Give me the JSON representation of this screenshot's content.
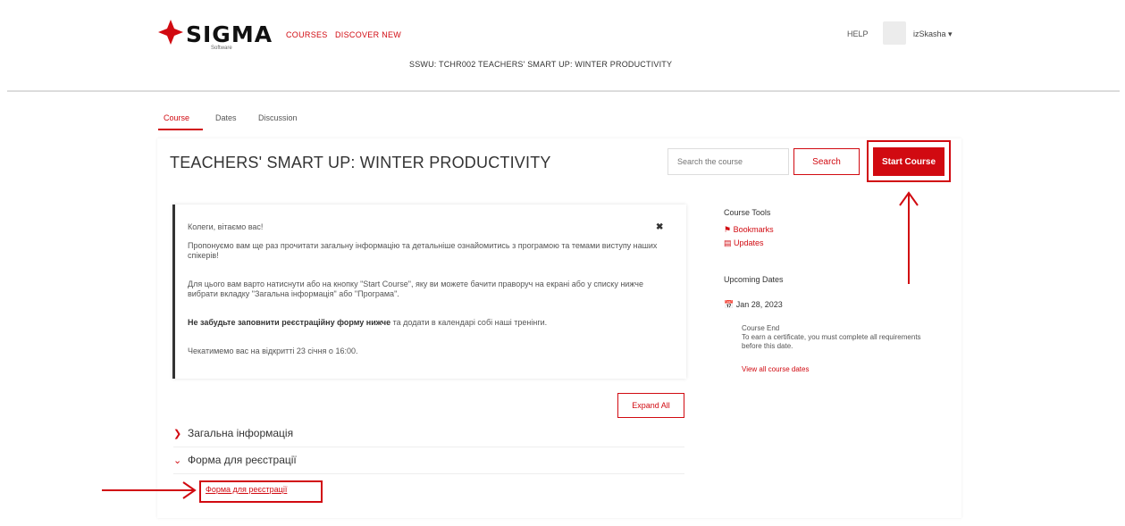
{
  "header": {
    "logo_text": "SIGMA",
    "logo_sub": "Software",
    "nav": [
      "COURSES",
      "DISCOVER NEW"
    ],
    "course_crumb": "SSWU: TCHR002 TEACHERS' SMART UP: WINTER PRODUCTIVITY",
    "help": "HELP",
    "username": "izSkasha ▾"
  },
  "tabs": [
    "Course",
    "Dates",
    "Discussion"
  ],
  "course": {
    "title": "TEACHERS' SMART UP: WINTER PRODUCTIVITY",
    "search_placeholder": "Search the course",
    "search_label": "Search",
    "start_label": "Start Course"
  },
  "welcome": {
    "greeting": "Колеги, вітаємо вас!",
    "p1": "Пропонуємо вам ще раз прочитати загальну інформацію та детальніше ознайомитись з програмою та темами виступу наших спікерів!",
    "p2": "Для цього вам варто натиснути або на кнопку \"Start Course\", яку ви можете бачити праворуч на екрані або у списку нижче вибрати вкладку \"Загальна інформація\" або \"Програма\".",
    "p3_bold": "Не забудьте заповнити реєстраційну форму нижче",
    "p3_rest": " та додати в календарі собі наші тренінги.",
    "p4": "Чекатимемо вас на відкритті 23 січня о 16:00.",
    "close": "✖"
  },
  "outline": {
    "expand_label": "Expand All",
    "sections": [
      {
        "chevron": "❯",
        "title": "Загальна інформація"
      },
      {
        "chevron": "⌄",
        "title": "Форма для реєстрації"
      }
    ],
    "subsection_link": "Форма для реєстрації"
  },
  "sidebar": {
    "tools_heading": "Course Tools",
    "bookmarks": "Bookmarks",
    "updates": "Updates",
    "dates_heading": "Upcoming Dates",
    "date": "Jan 28, 2023",
    "event_title": "Course End",
    "event_desc": "To earn a certificate, you must complete all requirements before this date.",
    "view_all": "View all course dates"
  },
  "colors": {
    "accent": "#d10a11"
  },
  "icons": [
    "sigma-logo-icon",
    "bookmark-icon",
    "updates-icon",
    "calendar-icon",
    "chevron-right-icon",
    "chevron-down-icon",
    "close-icon",
    "annotation-arrow-up",
    "annotation-arrow-right"
  ]
}
